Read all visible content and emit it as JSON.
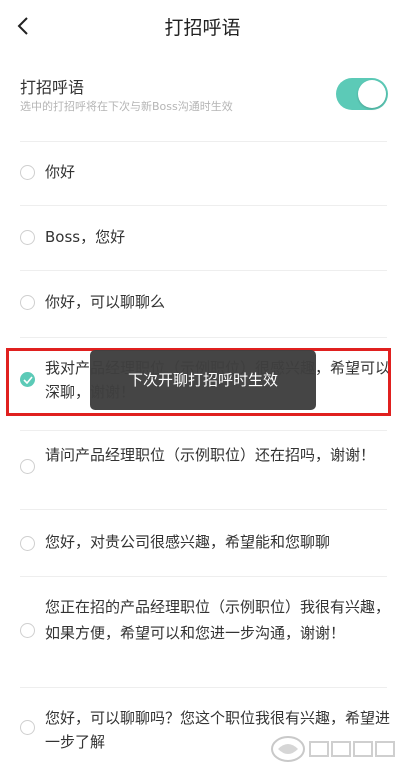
{
  "nav": {
    "title": "打招呼语",
    "back_icon": "back-arrow-icon"
  },
  "setting": {
    "label": "打招呼语",
    "description": "选中的打招呼将在下次与新Boss沟通时生效",
    "enabled": true,
    "accent_color": "#5ccab7"
  },
  "options": [
    {
      "text": "你好",
      "checked": false
    },
    {
      "text": "Boss，您好",
      "checked": false
    },
    {
      "text": "你好，可以聊聊么",
      "checked": false
    },
    {
      "text": "我对产品经理职位（示例职位）很感兴趣，希望可以深聊，谢谢！",
      "checked": true
    },
    {
      "text": "请问产品经理职位（示例职位）还在招吗，谢谢！",
      "checked": false
    },
    {
      "text": "您好，对贵公司很感兴趣，希望能和您聊聊",
      "checked": false
    },
    {
      "text": "您正在招的产品经理职位（示例职位）我很有兴趣，如果方便，希望可以和您进一步沟通，谢谢！",
      "checked": false
    },
    {
      "text": "您好，可以聊聊吗？您这个职位我很有兴趣，希望进一步了解",
      "checked": false
    }
  ],
  "toast": {
    "text": "下次开聊打招呼时生效"
  },
  "highlight_color": "#e0201f"
}
